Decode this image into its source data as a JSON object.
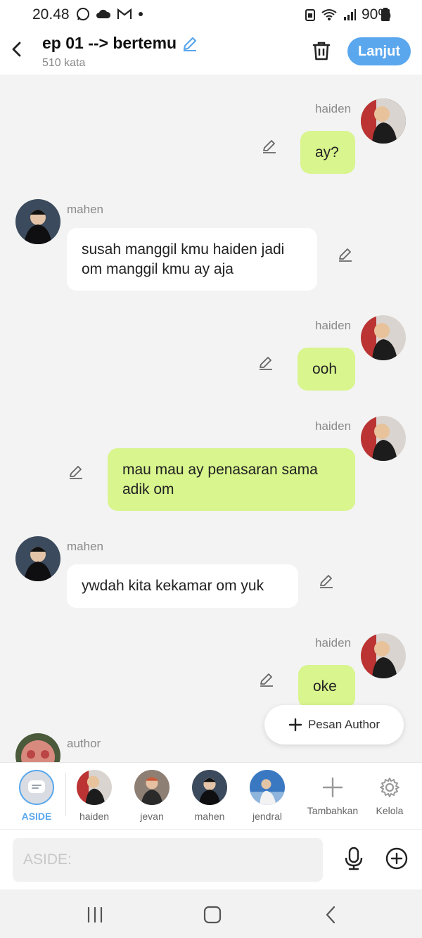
{
  "status": {
    "time": "20.48",
    "battery": "90%",
    "icons": [
      "whatsapp-icon",
      "cloud-icon",
      "gmail-icon",
      "dot-icon",
      "battery-saver-icon",
      "wifi-icon",
      "signal-icon",
      "battery-icon"
    ]
  },
  "header": {
    "title": "ep 01 --> bertemu",
    "subtitle": "510 kata",
    "next_label": "Lanjut"
  },
  "messages": [
    {
      "sender": "haiden",
      "text": "ay?",
      "side": "right"
    },
    {
      "sender": "mahen",
      "text": "susah manggil kmu haiden jadi om manggil kmu ay aja",
      "side": "left"
    },
    {
      "sender": "haiden",
      "text": "ooh",
      "side": "right"
    },
    {
      "sender": "haiden",
      "text": "mau mau ay penasaran sama adik om",
      "side": "right"
    },
    {
      "sender": "mahen",
      "text": "ywdah kita kekamar om yuk",
      "side": "left"
    },
    {
      "sender": "haiden",
      "text": "oke",
      "side": "right"
    },
    {
      "sender": "author",
      "text": "",
      "side": "left"
    }
  ],
  "pesan_author": "Pesan Author",
  "characters": [
    {
      "label": "ASIDE",
      "active": true
    },
    {
      "label": "haiden"
    },
    {
      "label": "jevan"
    },
    {
      "label": "mahen"
    },
    {
      "label": "jendral"
    },
    {
      "label": "Tambahkan"
    },
    {
      "label": "Kelola"
    }
  ],
  "input": {
    "placeholder": "ASIDE:"
  },
  "colors": {
    "accent": "#5aa7ee",
    "bubble_right": "#d8f58e",
    "bubble_left": "#ffffff",
    "background": "#f3f3f3"
  }
}
